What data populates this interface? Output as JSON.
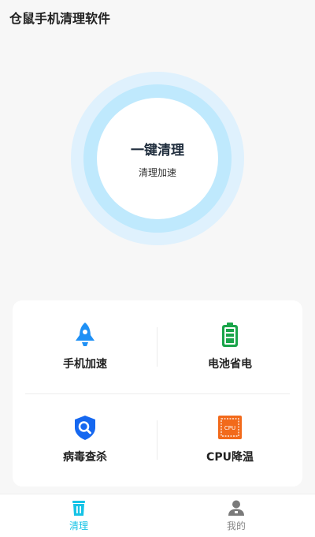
{
  "header": {
    "title": "仓鼠手机清理软件"
  },
  "clean_orb": {
    "title": "一键清理",
    "subtitle": "清理加速"
  },
  "features": [
    {
      "label": "手机加速",
      "icon": "rocket-icon"
    },
    {
      "label": "电池省电",
      "icon": "battery-icon"
    },
    {
      "label": "病毒查杀",
      "icon": "shield-search-icon"
    },
    {
      "label": "CPU降温",
      "icon": "cpu-chip-icon",
      "icon_text": "CPU"
    }
  ],
  "bottom_nav": [
    {
      "label": "清理",
      "icon": "trash-icon",
      "active": true
    },
    {
      "label": "我的",
      "icon": "user-icon",
      "active": false
    }
  ],
  "colors": {
    "accent": "#16c3e6",
    "rocket": "#1e90f5",
    "battery": "#1aa54a",
    "shield": "#1668f0",
    "cpu": "#f26a1b",
    "orb_outer": "#dff1fd",
    "orb_mid": "#bfe9fd"
  }
}
